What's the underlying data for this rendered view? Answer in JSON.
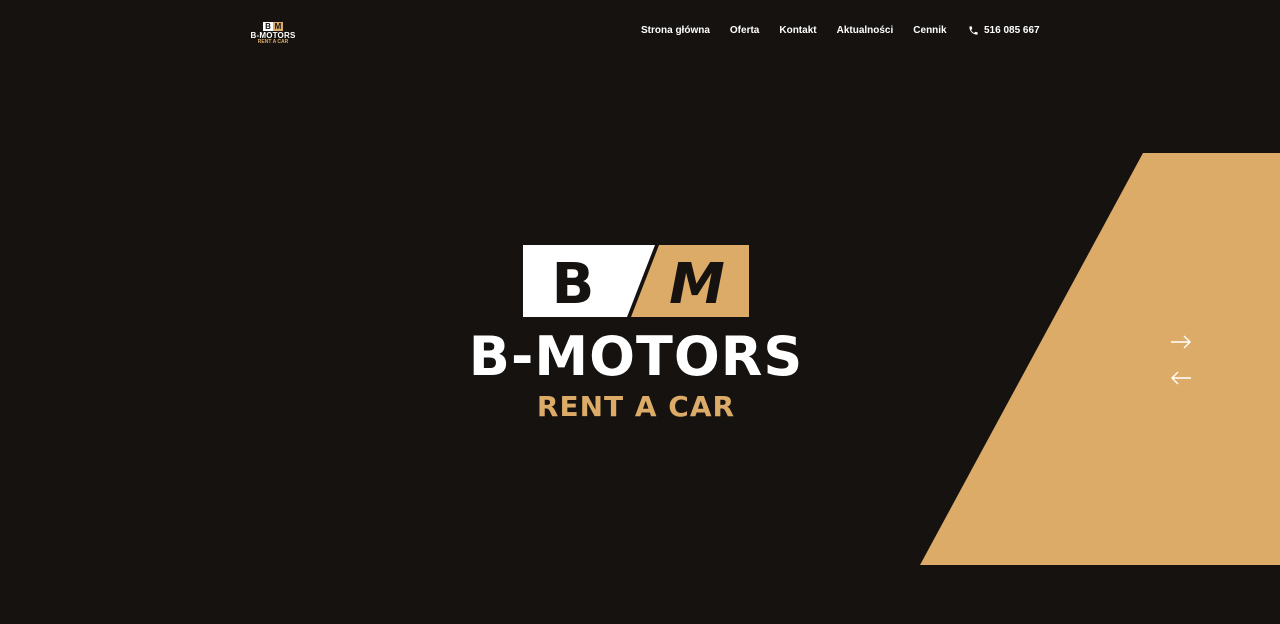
{
  "brand": {
    "mark_b": "B",
    "mark_m": "M",
    "name": "B-MOTORS",
    "tagline": "RENT A CAR"
  },
  "nav": {
    "items": [
      {
        "label": "Strona główna"
      },
      {
        "label": "Oferta"
      },
      {
        "label": "Kontakt"
      },
      {
        "label": "Aktualności"
      },
      {
        "label": "Cennik"
      }
    ]
  },
  "contact": {
    "phone": "516 085 667",
    "icon": "phone-icon"
  },
  "hero": {
    "mark_b": "B",
    "mark_m": "M",
    "name": "B-MOTORS",
    "tagline": "RENT A CAR"
  },
  "slider": {
    "next_icon": "arrow-right-icon",
    "prev_icon": "arrow-left-icon"
  },
  "colors": {
    "background": "#151210",
    "accent": "#dbab67",
    "text": "#ffffff"
  }
}
